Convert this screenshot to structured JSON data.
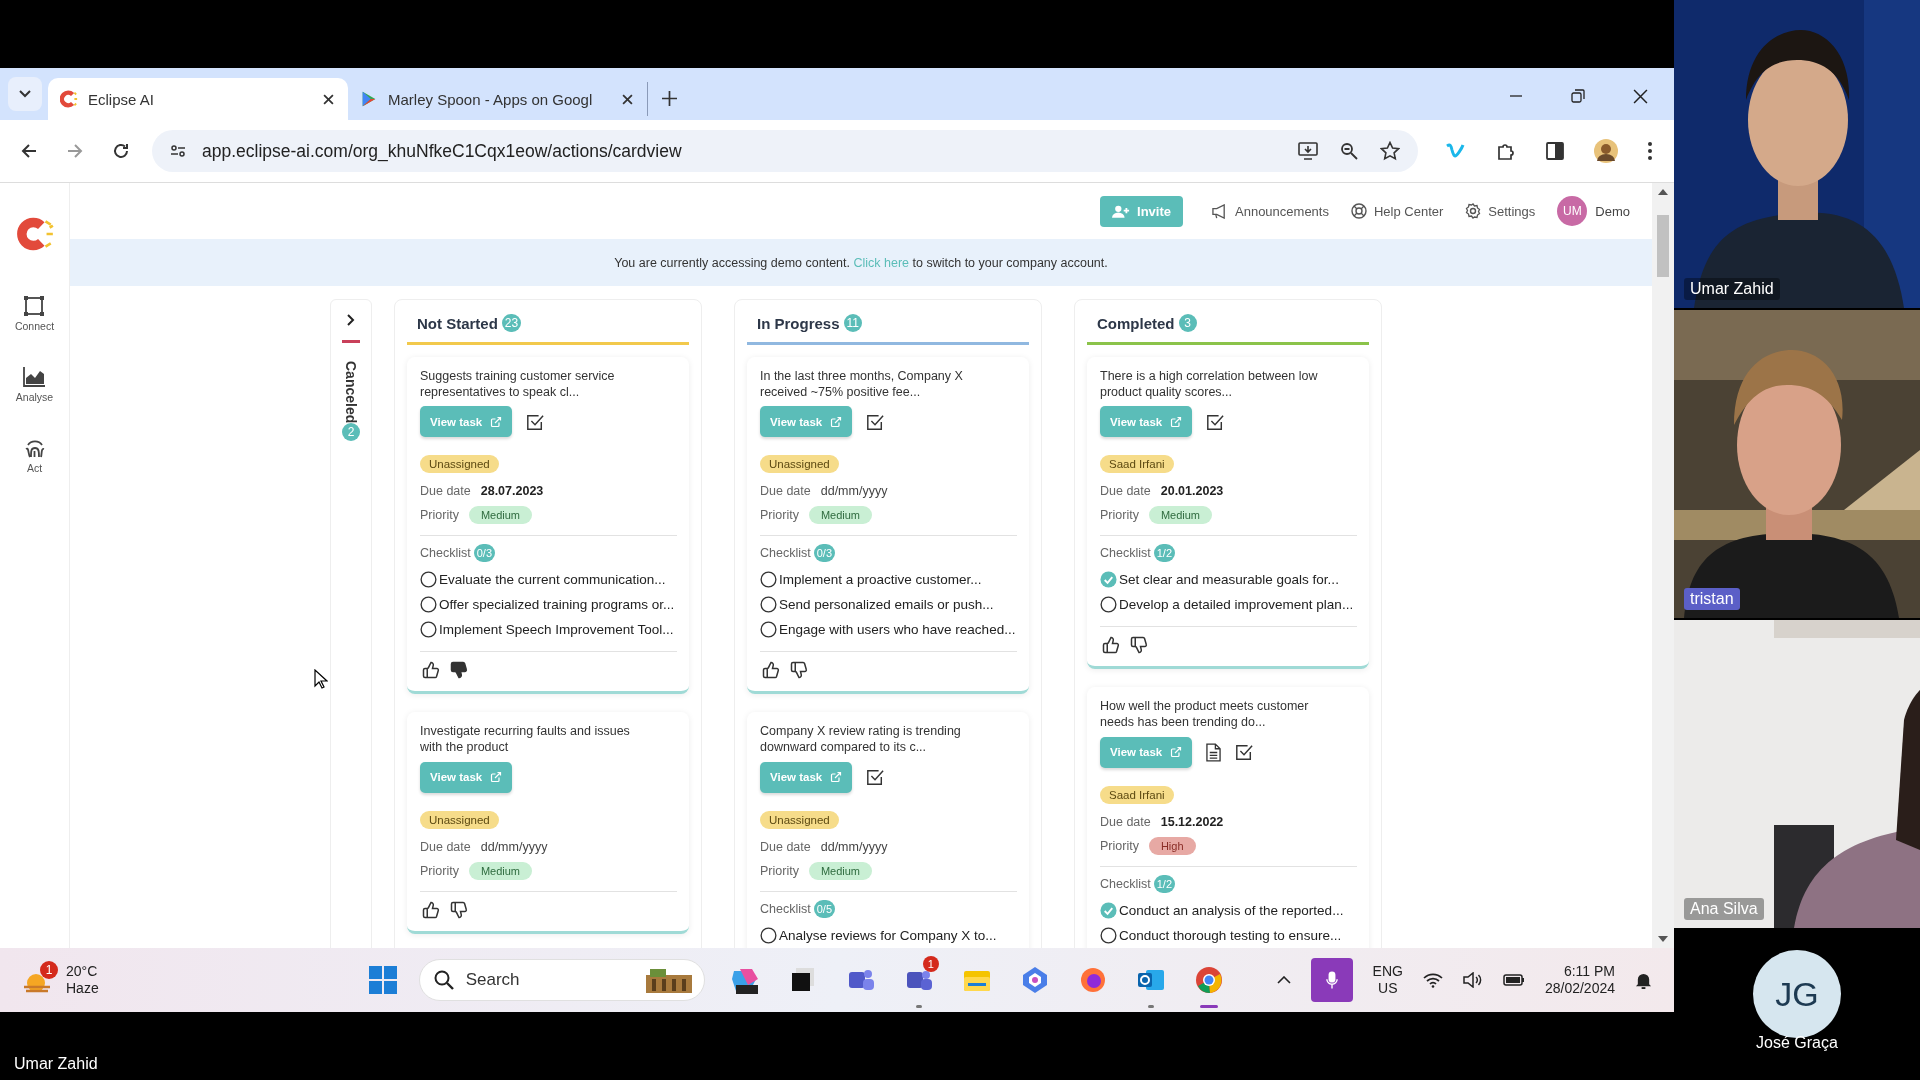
{
  "call": {
    "presenter": "Umar Zahid",
    "tiles": [
      {
        "name": "Umar Zahid",
        "kind": "picture",
        "highlight": false
      },
      {
        "name": "tristan",
        "kind": "picture",
        "highlight": true
      },
      {
        "name": "Ana Silva",
        "kind": "picture",
        "highlight": false
      }
    ],
    "avatar": {
      "initials": "JG",
      "name": "José Graça"
    }
  },
  "browser": {
    "tabs": [
      {
        "title": "Eclipse AI",
        "kind": "eclipse",
        "selected": true
      },
      {
        "title": "Marley Spoon - Apps on Googl",
        "kind": "play",
        "selected": false
      }
    ],
    "url": "app.eclipse-ai.com/org_khuNfkeC1Cqx1eow/actions/cardview"
  },
  "app": {
    "nav": [
      {
        "label": "Connect",
        "kind": "connect"
      },
      {
        "label": "Analyse",
        "kind": "analyse"
      },
      {
        "label": "Act",
        "kind": "act"
      }
    ],
    "invite": "Invite",
    "links": [
      {
        "label": "Announcements",
        "kind": "announce"
      },
      {
        "label": "Help Center",
        "kind": "help"
      },
      {
        "label": "Settings",
        "kind": "settings"
      }
    ],
    "user": {
      "initials": "UM",
      "name": "Demo"
    },
    "banner": {
      "before": "You are currently accessing demo content.",
      "link": "Click here",
      "after": "to switch to your company account."
    }
  },
  "board": {
    "canceled": {
      "label": "Canceled",
      "count": "2"
    },
    "columns": [
      {
        "title": "Not Started",
        "count": "23",
        "color": "#f2c94c",
        "cards": [
          {
            "summary": "Suggests training customer service representatives to speak cl...",
            "button": "View task",
            "has_note": false,
            "has_check": true,
            "assignee": "Unassigned",
            "due_label": "Due date",
            "due": {
              "value": "28.07.2023"
            },
            "priority_label": "Priority",
            "priority": {
              "label": "Medium",
              "kind": "medium"
            },
            "checklist": {
              "label": "Checklist",
              "count": "0/3",
              "items": [
                {
                  "text": "Evaluate the current communication...",
                  "checked": false
                },
                {
                  "text": "Offer specialized training programs or...",
                  "checked": false
                },
                {
                  "text": "Implement Speech Improvement Tool...",
                  "checked": false
                }
              ]
            },
            "disliked": true
          },
          {
            "summary": "Investigate recurring faults and issues with the product",
            "button": "View task",
            "has_note": false,
            "has_check": false,
            "assignee": "Unassigned",
            "due_label": "Due date",
            "due": {
              "placeholder": "dd/mm/yyyy"
            },
            "priority_label": "Priority",
            "priority": {
              "label": "Medium",
              "kind": "medium"
            },
            "disliked": false
          }
        ]
      },
      {
        "title": "In Progress",
        "count": "11",
        "color": "#90b8e0",
        "cards": [
          {
            "summary": "In the last three months, Company X received ~75% positive fee...",
            "button": "View task",
            "has_note": false,
            "has_check": true,
            "assignee": "Unassigned",
            "due_label": "Due date",
            "due": {
              "placeholder": "dd/mm/yyyy"
            },
            "priority_label": "Priority",
            "priority": {
              "label": "Medium",
              "kind": "medium"
            },
            "checklist": {
              "label": "Checklist",
              "count": "0/3",
              "items": [
                {
                  "text": "Implement a proactive customer...",
                  "checked": false
                },
                {
                  "text": "Send personalized emails or push...",
                  "checked": false
                },
                {
                  "text": "Engage with users who have reached...",
                  "checked": false
                }
              ]
            },
            "disliked": false
          },
          {
            "summary": "Company X review rating is trending downward compared to its c...",
            "button": "View task",
            "has_note": false,
            "has_check": true,
            "assignee": "Unassigned",
            "due_label": "Due date",
            "due": {
              "placeholder": "dd/mm/yyyy"
            },
            "priority_label": "Priority",
            "priority": {
              "label": "Medium",
              "kind": "medium"
            },
            "checklist": {
              "label": "Checklist",
              "count": "0/5",
              "items": [
                {
                  "text": "Analyse reviews for Company X to...",
                  "checked": false
                }
              ]
            }
          }
        ]
      },
      {
        "title": "Completed",
        "count": "3",
        "color": "#8bc34a",
        "cards": [
          {
            "summary": "There is a high correlation between low product quality scores...",
            "button": "View task",
            "has_note": false,
            "has_check": true,
            "assignee": "Saad Irfani",
            "due_label": "Due date",
            "due": {
              "value": "20.01.2023"
            },
            "priority_label": "Priority",
            "priority": {
              "label": "Medium",
              "kind": "medium"
            },
            "checklist": {
              "label": "Checklist",
              "count": "1/2",
              "items": [
                {
                  "text": "Set clear and measurable goals for...",
                  "checked": true
                },
                {
                  "text": "Develop a detailed improvement plan...",
                  "checked": false
                }
              ]
            },
            "disliked": false
          },
          {
            "summary": "How well the product meets customer needs has been trending do...",
            "button": "View task",
            "has_note": true,
            "has_check": true,
            "assignee": "Saad Irfani",
            "due_label": "Due date",
            "due": {
              "value": "15.12.2022"
            },
            "priority_label": "Priority",
            "priority": {
              "label": "High",
              "kind": "high"
            },
            "checklist": {
              "label": "Checklist",
              "count": "1/2",
              "items": [
                {
                  "text": "Conduct an analysis of the reported...",
                  "checked": true
                },
                {
                  "text": "Conduct thorough testing to ensure...",
                  "checked": false
                }
              ]
            }
          }
        ]
      }
    ]
  },
  "taskbar": {
    "weather": {
      "badge": "1",
      "temp": "20°C",
      "text": "Haze"
    },
    "search": "Search",
    "apps": [
      {
        "kind": "copilot-pre",
        "running": false,
        "selected": false
      },
      {
        "kind": "files",
        "running": false,
        "selected": false
      },
      {
        "kind": "teams",
        "running": false,
        "selected": false
      },
      {
        "kind": "teams-work",
        "running": true,
        "selected": false,
        "badge": "1"
      },
      {
        "kind": "explorer",
        "running": false,
        "selected": false
      },
      {
        "kind": "copilot",
        "running": false,
        "selected": false
      },
      {
        "kind": "firefox",
        "running": false,
        "selected": false
      },
      {
        "kind": "outlook",
        "running": true,
        "selected": false
      },
      {
        "kind": "chrome",
        "running": true,
        "selected": true
      }
    ],
    "lang": [
      "ENG",
      "US"
    ],
    "time": "6:11 PM",
    "date": "28/02/2024"
  }
}
